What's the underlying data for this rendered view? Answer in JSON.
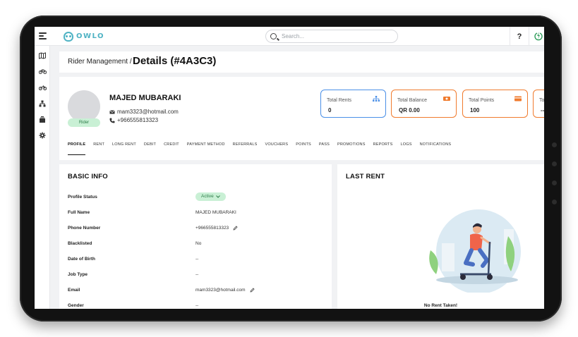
{
  "app": {
    "logo_text": "OWLO"
  },
  "search": {
    "placeholder": "Search..."
  },
  "topbar": {
    "help_label": "?"
  },
  "header": {
    "breadcrumb": "Rider Management /",
    "title": "Details (#4A3C3)"
  },
  "profile": {
    "name": "MAJED MUBARAKI",
    "email": "mam3323@hotmail.com",
    "phone": "+966555813323",
    "role": "Rider"
  },
  "stats": [
    {
      "label": "Total Rents",
      "value": "0",
      "color": "#4a8fe7",
      "icon": "hierarchy-icon"
    },
    {
      "label": "Total Balance",
      "value": "QR 0.00",
      "color": "#f07b2e",
      "icon": "money-icon"
    },
    {
      "label": "Total Points",
      "value": "100",
      "color": "#f07b2e",
      "icon": "card-icon"
    },
    {
      "label": "To",
      "value": "--",
      "color": "#f07b2e",
      "icon": ""
    }
  ],
  "tabs": [
    "PROFILE",
    "RENT",
    "LONG RENT",
    "DEBIT",
    "CREDIT",
    "PAYMENT METHOD",
    "REFERRALS",
    "VOUCHERS",
    "POINTS",
    "PASS",
    "PROMOTIONS",
    "REPORTS",
    "LOGS",
    "NOTIFICATIONS"
  ],
  "basic_info": {
    "title": "BASIC INFO",
    "rows": [
      {
        "key": "Profile Status",
        "value": "Active"
      },
      {
        "key": "Full Name",
        "value": "MAJED MUBARAKI"
      },
      {
        "key": "Phone Number",
        "value": "+966555813323"
      },
      {
        "key": "Blacklisted",
        "value": "No"
      },
      {
        "key": "Date of Birth",
        "value": "--"
      },
      {
        "key": "Job Type",
        "value": "--"
      },
      {
        "key": "Email",
        "value": "mam3323@hotmail.com"
      },
      {
        "key": "Gender",
        "value": "--"
      }
    ]
  },
  "last_rent": {
    "title": "LAST RENT",
    "empty_text": "No Rent Taken!"
  },
  "colors": {
    "accent": "#4fb3c4",
    "active_green": "#c9f0d5",
    "blue": "#4a8fe7",
    "orange": "#f07b2e"
  }
}
